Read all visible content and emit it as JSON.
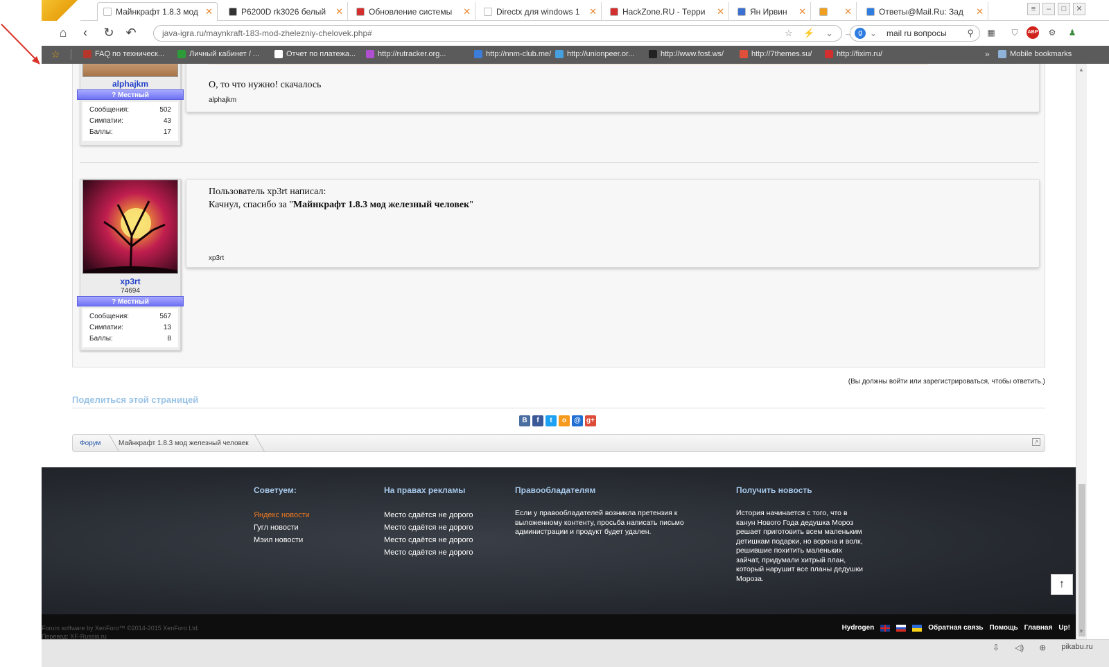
{
  "browser": {
    "tabs": [
      {
        "label": "Майнкрафт 1.8.3 мод",
        "icon_color": "#ffffff",
        "active": true
      },
      {
        "label": "P6200D rk3026 белый",
        "icon_color": "#333333"
      },
      {
        "label": "Обновление системы",
        "icon_color": "#d32f2f"
      },
      {
        "label": "Directx для windows 1",
        "icon_color": "#ffffff"
      },
      {
        "label": "HackZone.RU - Терри",
        "icon_color": "#d32f2f"
      },
      {
        "label": "Ян Ирвин",
        "icon_color": "#3b6fd1"
      },
      {
        "label": "",
        "icon_color": "#f0a020"
      },
      {
        "label": "Ответы@Mail.Ru: Зад",
        "icon_color": "#2f7de1"
      }
    ],
    "close_glyph": "✕",
    "new_tab_glyph": "+",
    "url": "java-igra.ru/maynkraft-183-mod-zhelezniy-chelovek.php#",
    "search_value": "mail ru вопросы",
    "search_engine_letter": "g",
    "bookmarks": [
      {
        "label": "FAQ по техническ...",
        "icon_color": "#b5372b"
      },
      {
        "label": "Личный кабинет / ...",
        "icon_color": "#2e9b3a"
      },
      {
        "label": "Отчет по платежа...",
        "icon_color": "#ffffff"
      },
      {
        "label": "http://rutracker.org...",
        "icon_color": "#b04fd0"
      },
      {
        "label": "http://nnm-club.me/",
        "icon_color": "#3b7dd8"
      },
      {
        "label": "http://unionpeer.or...",
        "icon_color": "#46a0e0"
      },
      {
        "label": "http://www.fost.ws/",
        "icon_color": "#222222"
      },
      {
        "label": "http://7themes.su/",
        "icon_color": "#e04f3a"
      },
      {
        "label": "http://fixim.ru/",
        "icon_color": "#d32f2f"
      }
    ],
    "bookmarks_more": "»",
    "mobile_bookmarks": "Mobile bookmarks"
  },
  "posts": [
    {
      "username": "alphajkm",
      "rank": "? Местный",
      "stats": [
        {
          "label": "Сообщения:",
          "value": "502"
        },
        {
          "label": "Симпатии:",
          "value": "43"
        },
        {
          "label": "Баллы:",
          "value": "17"
        }
      ],
      "body": "О, то что нужно! скачалось",
      "signature": "alphajkm"
    },
    {
      "username": "xp3rt",
      "user_extra": "74694",
      "rank": "? Местный",
      "stats": [
        {
          "label": "Сообщения:",
          "value": "567"
        },
        {
          "label": "Симпатии:",
          "value": "13"
        },
        {
          "label": "Баллы:",
          "value": "8"
        }
      ],
      "quote_intro": "Пользователь xp3rt написал:",
      "body_prefix": "Качнул, спасибо за \"",
      "body_bold": "Майнкрафт 1.8.3 мод железный человек",
      "body_suffix": "\"",
      "signature": "xp3rt"
    }
  ],
  "login_note": "(Вы должны войти или зарегистрироваться, чтобы ответить.)",
  "share": {
    "title": "Поделиться этой страницей",
    "buttons": [
      {
        "label": "В",
        "color": "#4a6e9f"
      },
      {
        "label": "f",
        "color": "#3b5998"
      },
      {
        "label": "t",
        "color": "#1da1f2"
      },
      {
        "label": "о",
        "color": "#f59a1d"
      },
      {
        "label": "@",
        "color": "#1f6fd2"
      },
      {
        "label": "g+",
        "color": "#dd4b39"
      }
    ]
  },
  "breadcrumb": {
    "home": "Форум",
    "current": "Майнкрафт 1.8.3 мод железный человек"
  },
  "footer": {
    "col1": {
      "title": "Советуем:",
      "links": [
        "Яндекс новости",
        "Гугл новости",
        "Мэил новости"
      ]
    },
    "col2": {
      "title": "На правах рекламы",
      "links": [
        "Место сдаётся не дорого",
        "Место сдаётся не дорого",
        "Место сдаётся не дорого",
        "Место сдаётся не дорого"
      ]
    },
    "col3": {
      "title": "Правообладателям",
      "text": "Если у правообладателей возникла претензия к выложенному контенту, просьба написать письмо администрации и продукт будет удален."
    },
    "col4": {
      "title": "Получить новость",
      "text": "История начинается с того, что в канун Нового Года дедушка Мороз решает приготовить всем маленьким детишкам подарки, но ворона и волк, решившие похитить маленьких зайчат, придумали хитрый план, который нарушит все планы дедушки Мороза."
    },
    "totop": "↑",
    "copyright_line1": "Forum software by XenForo™ ©2014-2015 XenForo Ltd.",
    "copyright_line2": "Перевод: XF-Russia.ru",
    "style_name": "Hydrogen",
    "links": [
      "Обратная связь",
      "Помощь",
      "Главная",
      "Up!"
    ]
  },
  "colors": {
    "link_blue": "#2241c8",
    "share_title": "#9ac3e6",
    "footer_heading": "#a7c8ea",
    "footer_highlight": "#f07a22"
  },
  "watermark": "pikabu.ru"
}
